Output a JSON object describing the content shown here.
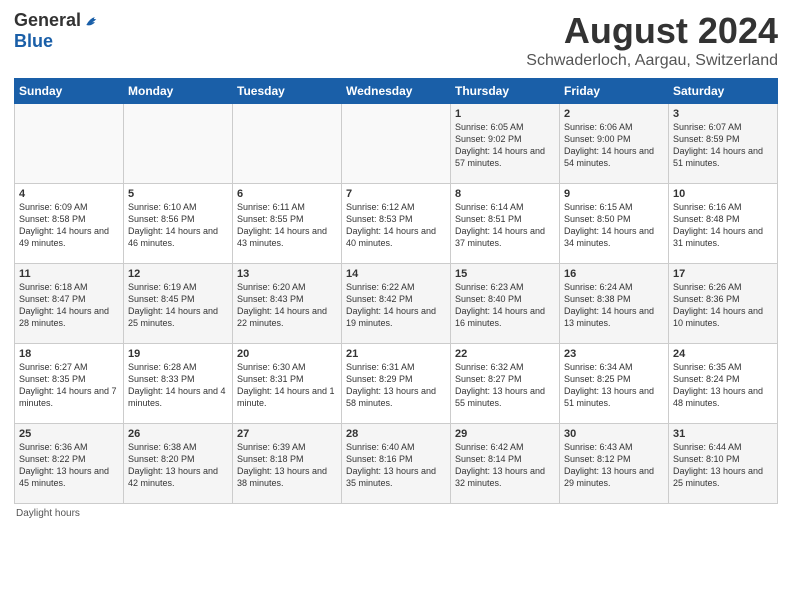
{
  "header": {
    "logo_general": "General",
    "logo_blue": "Blue",
    "title": "August 2024",
    "subtitle": "Schwaderloch, Aargau, Switzerland"
  },
  "weekdays": [
    "Sunday",
    "Monday",
    "Tuesday",
    "Wednesday",
    "Thursday",
    "Friday",
    "Saturday"
  ],
  "rows": [
    [
      {
        "day": "",
        "content": ""
      },
      {
        "day": "",
        "content": ""
      },
      {
        "day": "",
        "content": ""
      },
      {
        "day": "",
        "content": ""
      },
      {
        "day": "1",
        "content": "Sunrise: 6:05 AM\nSunset: 9:02 PM\nDaylight: 14 hours and 57 minutes."
      },
      {
        "day": "2",
        "content": "Sunrise: 6:06 AM\nSunset: 9:00 PM\nDaylight: 14 hours and 54 minutes."
      },
      {
        "day": "3",
        "content": "Sunrise: 6:07 AM\nSunset: 8:59 PM\nDaylight: 14 hours and 51 minutes."
      }
    ],
    [
      {
        "day": "4",
        "content": "Sunrise: 6:09 AM\nSunset: 8:58 PM\nDaylight: 14 hours and 49 minutes."
      },
      {
        "day": "5",
        "content": "Sunrise: 6:10 AM\nSunset: 8:56 PM\nDaylight: 14 hours and 46 minutes."
      },
      {
        "day": "6",
        "content": "Sunrise: 6:11 AM\nSunset: 8:55 PM\nDaylight: 14 hours and 43 minutes."
      },
      {
        "day": "7",
        "content": "Sunrise: 6:12 AM\nSunset: 8:53 PM\nDaylight: 14 hours and 40 minutes."
      },
      {
        "day": "8",
        "content": "Sunrise: 6:14 AM\nSunset: 8:51 PM\nDaylight: 14 hours and 37 minutes."
      },
      {
        "day": "9",
        "content": "Sunrise: 6:15 AM\nSunset: 8:50 PM\nDaylight: 14 hours and 34 minutes."
      },
      {
        "day": "10",
        "content": "Sunrise: 6:16 AM\nSunset: 8:48 PM\nDaylight: 14 hours and 31 minutes."
      }
    ],
    [
      {
        "day": "11",
        "content": "Sunrise: 6:18 AM\nSunset: 8:47 PM\nDaylight: 14 hours and 28 minutes."
      },
      {
        "day": "12",
        "content": "Sunrise: 6:19 AM\nSunset: 8:45 PM\nDaylight: 14 hours and 25 minutes."
      },
      {
        "day": "13",
        "content": "Sunrise: 6:20 AM\nSunset: 8:43 PM\nDaylight: 14 hours and 22 minutes."
      },
      {
        "day": "14",
        "content": "Sunrise: 6:22 AM\nSunset: 8:42 PM\nDaylight: 14 hours and 19 minutes."
      },
      {
        "day": "15",
        "content": "Sunrise: 6:23 AM\nSunset: 8:40 PM\nDaylight: 14 hours and 16 minutes."
      },
      {
        "day": "16",
        "content": "Sunrise: 6:24 AM\nSunset: 8:38 PM\nDaylight: 14 hours and 13 minutes."
      },
      {
        "day": "17",
        "content": "Sunrise: 6:26 AM\nSunset: 8:36 PM\nDaylight: 14 hours and 10 minutes."
      }
    ],
    [
      {
        "day": "18",
        "content": "Sunrise: 6:27 AM\nSunset: 8:35 PM\nDaylight: 14 hours and 7 minutes."
      },
      {
        "day": "19",
        "content": "Sunrise: 6:28 AM\nSunset: 8:33 PM\nDaylight: 14 hours and 4 minutes."
      },
      {
        "day": "20",
        "content": "Sunrise: 6:30 AM\nSunset: 8:31 PM\nDaylight: 14 hours and 1 minute."
      },
      {
        "day": "21",
        "content": "Sunrise: 6:31 AM\nSunset: 8:29 PM\nDaylight: 13 hours and 58 minutes."
      },
      {
        "day": "22",
        "content": "Sunrise: 6:32 AM\nSunset: 8:27 PM\nDaylight: 13 hours and 55 minutes."
      },
      {
        "day": "23",
        "content": "Sunrise: 6:34 AM\nSunset: 8:25 PM\nDaylight: 13 hours and 51 minutes."
      },
      {
        "day": "24",
        "content": "Sunrise: 6:35 AM\nSunset: 8:24 PM\nDaylight: 13 hours and 48 minutes."
      }
    ],
    [
      {
        "day": "25",
        "content": "Sunrise: 6:36 AM\nSunset: 8:22 PM\nDaylight: 13 hours and 45 minutes."
      },
      {
        "day": "26",
        "content": "Sunrise: 6:38 AM\nSunset: 8:20 PM\nDaylight: 13 hours and 42 minutes."
      },
      {
        "day": "27",
        "content": "Sunrise: 6:39 AM\nSunset: 8:18 PM\nDaylight: 13 hours and 38 minutes."
      },
      {
        "day": "28",
        "content": "Sunrise: 6:40 AM\nSunset: 8:16 PM\nDaylight: 13 hours and 35 minutes."
      },
      {
        "day": "29",
        "content": "Sunrise: 6:42 AM\nSunset: 8:14 PM\nDaylight: 13 hours and 32 minutes."
      },
      {
        "day": "30",
        "content": "Sunrise: 6:43 AM\nSunset: 8:12 PM\nDaylight: 13 hours and 29 minutes."
      },
      {
        "day": "31",
        "content": "Sunrise: 6:44 AM\nSunset: 8:10 PM\nDaylight: 13 hours and 25 minutes."
      }
    ]
  ],
  "footer": {
    "note": "Daylight hours"
  }
}
